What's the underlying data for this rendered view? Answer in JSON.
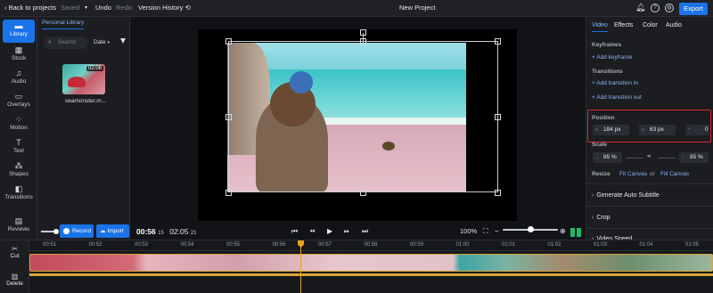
{
  "topbar": {
    "back_label": "Back to projects",
    "saved_label": "Saved",
    "undo_label": "Undo",
    "redo_label": "Redo",
    "version_history_label": "Version History",
    "project_title": "New Project",
    "export_label": "Export"
  },
  "leftnav": {
    "items": [
      {
        "label": "Library",
        "icon": "folder-icon",
        "active": true
      },
      {
        "label": "Stock",
        "icon": "grid-icon"
      },
      {
        "label": "Audio",
        "icon": "music-note-icon"
      },
      {
        "label": "Overlays",
        "icon": "overlay-icon"
      },
      {
        "label": "Motion",
        "icon": "motion-icon"
      },
      {
        "label": "Text",
        "icon": "text-icon"
      },
      {
        "label": "Shapes",
        "icon": "shapes-icon"
      },
      {
        "label": "Transitions",
        "icon": "transitions-icon"
      },
      {
        "label": "Reviews",
        "icon": "chat-icon"
      }
    ]
  },
  "library": {
    "tab_label": "Personal Library",
    "search_placeholder": "Search",
    "sort_label": "Date",
    "media": [
      {
        "name": "seamonster.m...",
        "duration": "02:06"
      }
    ],
    "record_label": "Record",
    "import_label": "Import"
  },
  "player": {
    "current_time": "00:56",
    "current_frames": "15",
    "total_time": "02:05",
    "total_frames": "21",
    "zoom": "100%",
    "volume_level": 0.5
  },
  "properties": {
    "tabs": [
      "Video",
      "Effects",
      "Color",
      "Audio"
    ],
    "active_tab": "Video",
    "keyframes_title": "Keyframes",
    "add_keyframe": "+ Add keyframe",
    "transitions_title": "Transitions",
    "add_transition_in": "+ Add transition in",
    "add_transition_out": "+ Add transition out",
    "position_title": "Position",
    "position": {
      "x": "184 px",
      "y": "83 px",
      "r": "0"
    },
    "scale_title": "Scale",
    "scale": {
      "w": "85 %",
      "h": "85 %"
    },
    "resize_title": "Resize",
    "fit_canvas": "Fit Canvas",
    "or_label": "or",
    "fill_canvas": "Fill Canvas",
    "accordions": [
      "Generate Auto Subtitle",
      "Crop",
      "Video Speed"
    ]
  },
  "timeline": {
    "cut_label": "Cut",
    "delete_label": "Delete",
    "ticks": [
      "00:51",
      "00:52",
      "00:53",
      "00:54",
      "00:55",
      "00:56",
      "00:57",
      "00:58",
      "00:59",
      "01:00",
      "01:01",
      "01:02",
      "01:03",
      "01:04",
      "01:05"
    ]
  },
  "colors": {
    "accent": "#1a73e8",
    "highlight": "#e02828",
    "playhead": "#e8a11f"
  }
}
